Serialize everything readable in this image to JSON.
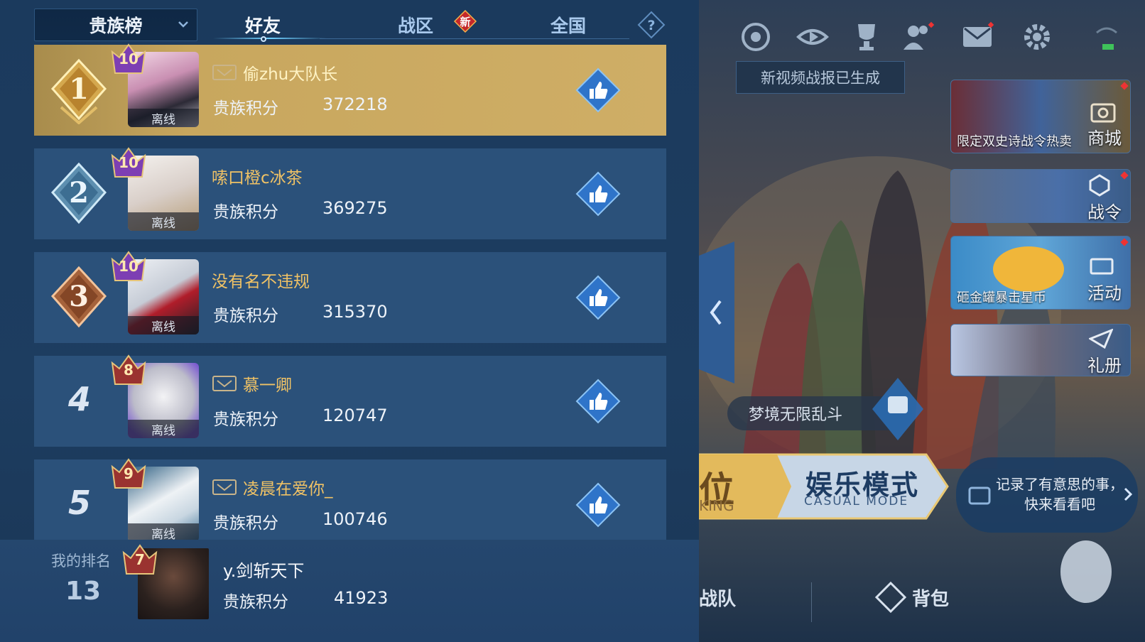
{
  "header": {
    "dropdown_label": "贵族榜",
    "tabs": [
      {
        "label": "好友",
        "active": true
      },
      {
        "label": "战区",
        "badge": "新"
      },
      {
        "label": "全国"
      }
    ]
  },
  "leaderboard": [
    {
      "rank": "1",
      "level": "10",
      "name": "偷zhu大队长",
      "score_label": "贵族积分",
      "score": "372218",
      "status": "离线",
      "has_card_icon": true
    },
    {
      "rank": "2",
      "level": "10",
      "name": "嗦口橙c冰茶",
      "score_label": "贵族积分",
      "score": "369275",
      "status": "离线",
      "has_card_icon": false
    },
    {
      "rank": "3",
      "level": "10",
      "name": "没有名不违规",
      "score_label": "贵族积分",
      "score": "315370",
      "status": "离线",
      "has_card_icon": false
    },
    {
      "rank": "4",
      "level": "8",
      "name": "慕一卿",
      "score_label": "贵族积分",
      "score": "120747",
      "status": "离线",
      "has_card_icon": true
    },
    {
      "rank": "5",
      "level": "9",
      "name": "凌晨在爱你_",
      "score_label": "贵族积分",
      "score": "100746",
      "status": "离线",
      "has_card_icon": true
    }
  ],
  "my_rank": {
    "label": "我的排名",
    "rank": "13",
    "level": "7",
    "name": "y.剑斩天下",
    "score_label": "贵族积分",
    "score": "41923"
  },
  "right_panel": {
    "notice": "新视频战报已生成",
    "cards": [
      {
        "text": "限定双史诗战令热卖",
        "label": "商城"
      },
      {
        "text": "",
        "label": "战令"
      },
      {
        "text": "砸金罐暴击星币",
        "label": "活动"
      },
      {
        "text": "",
        "label": "礼册"
      }
    ],
    "dream_bar": "梦境无限乱斗",
    "rank_partial": "位",
    "king_partial": "KING",
    "casual_title": "娱乐模式",
    "casual_sub": "CASUAL MODE",
    "bubble_text": "记录了有意思的事，快来看看吧",
    "bottom_nav": [
      {
        "label": "战队"
      },
      {
        "label": "背包"
      }
    ],
    "icons": [
      "radar-icon",
      "replay-eye-icon",
      "trophy-icon",
      "friends-icon",
      "mail-icon",
      "settings-gear-icon",
      "signal-battery-icon"
    ]
  },
  "colors": {
    "accent_gold": "#f0c265",
    "row_bg": "#2b517a",
    "first_row_bg": "#cfae66"
  }
}
